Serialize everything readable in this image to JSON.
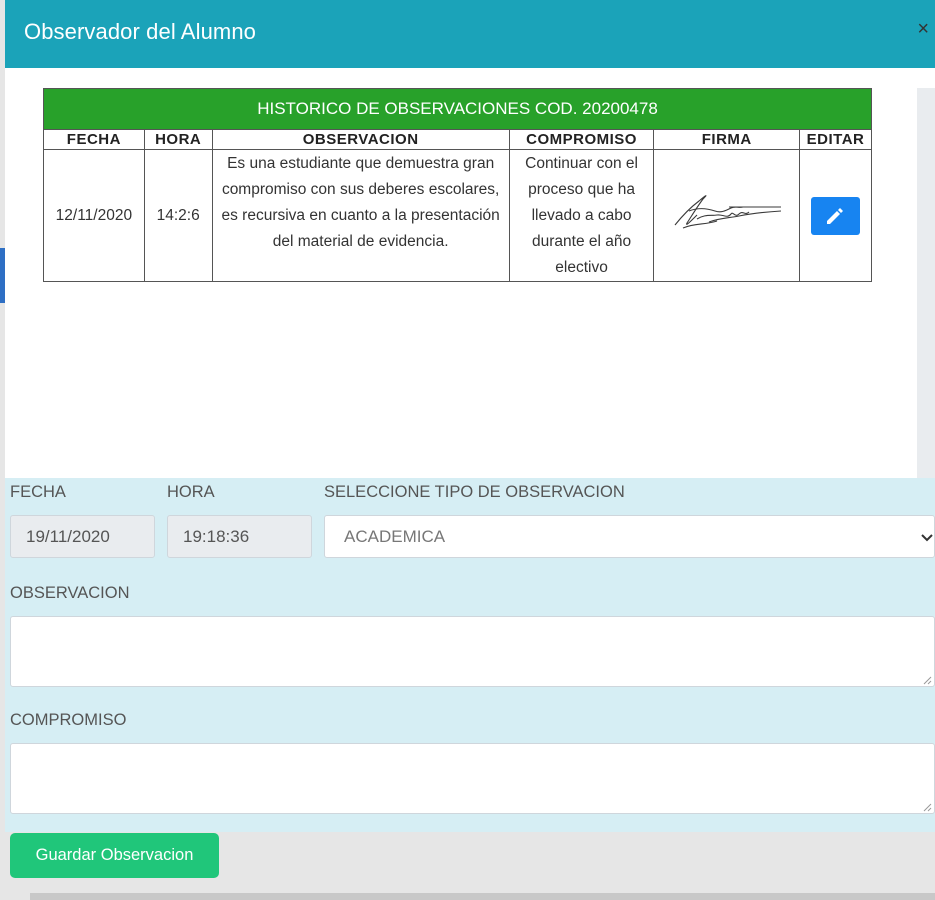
{
  "modal": {
    "title": "Observador del Alumno",
    "close_label": "×"
  },
  "history": {
    "title": "HISTORICO DE OBSERVACIONES COD. 20200478",
    "columns": [
      "FECHA",
      "HORA",
      "OBSERVACION",
      "COMPROMISO",
      "FIRMA",
      "EDITAR"
    ],
    "rows": [
      {
        "fecha": "12/11/2020",
        "hora": "14:2:6",
        "observacion": "Es una estudiante que demuestra gran compromiso con sus deberes escolares, es recursiva en cuanto a la presentación del material de evidencia.",
        "compromiso": "Continuar con el proceso que ha llevado a cabo durante el año electivo"
      }
    ]
  },
  "form": {
    "fecha_label": "FECHA",
    "fecha_value": "19/11/2020",
    "hora_label": "HORA",
    "hora_value": "19:18:36",
    "tipo_label": "SELECCIONE TIPO DE OBSERVACION",
    "tipo_value": "ACADEMICA",
    "observacion_label": "OBSERVACION",
    "compromiso_label": "COMPROMISO",
    "save_label": "Guardar Observacion"
  },
  "colors": {
    "header": "#1ba3b9",
    "table_title": "#28a12a",
    "edit_button": "#1784f1",
    "form_background": "#d6eef4",
    "save_button": "#20c67a"
  },
  "icons": [
    "close-icon",
    "pencil-icon",
    "signature-image",
    "chevron-down-icon"
  ]
}
